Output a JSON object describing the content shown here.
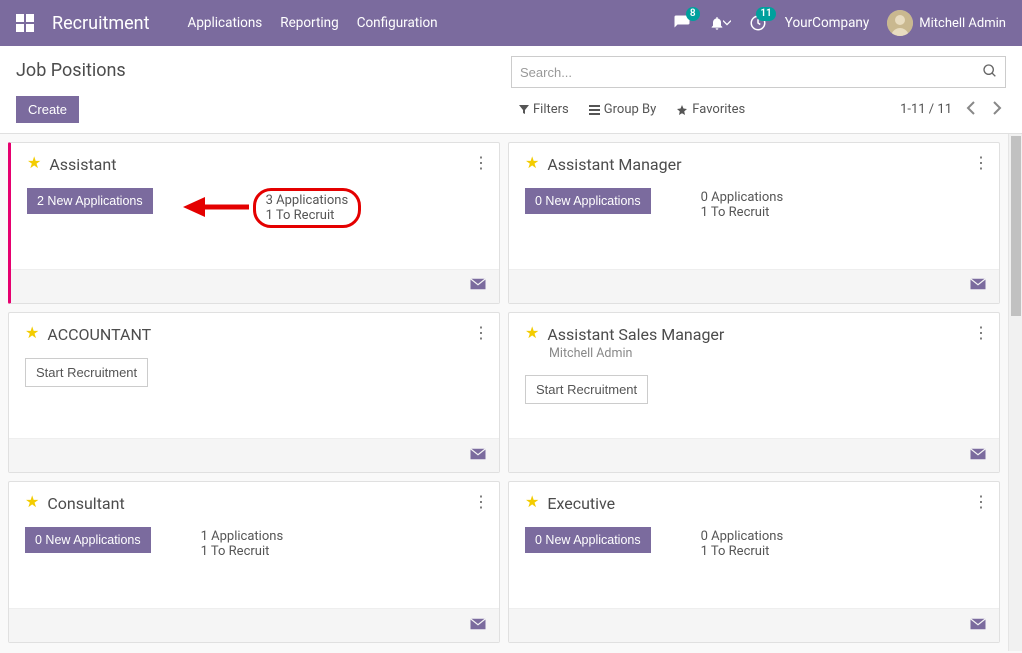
{
  "nav": {
    "brand": "Recruitment",
    "menus": [
      "Applications",
      "Reporting",
      "Configuration"
    ],
    "chat_badge": "8",
    "activity_badge": "11",
    "company": "YourCompany",
    "user": "Mitchell Admin"
  },
  "cp": {
    "title": "Job Positions",
    "create": "Create",
    "search_placeholder": "Search...",
    "filters": "Filters",
    "groupby": "Group By",
    "favorites": "Favorites",
    "pager": "1-11 / 11"
  },
  "cards": [
    {
      "title": "Assistant",
      "highlight": true,
      "new_apps": "2 New Applications",
      "s1": "3 Applications",
      "s2": "1 To Recruit",
      "stats_highlight": true,
      "arrow": true
    },
    {
      "title": "Assistant Manager",
      "new_apps": "0 New Applications",
      "s1": "0 Applications",
      "s2": "1 To Recruit"
    },
    {
      "title": "ACCOUNTANT",
      "start_btn": "Start Recruitment"
    },
    {
      "title": "Assistant Sales Manager",
      "subtitle": "Mitchell Admin",
      "start_btn": "Start Recruitment"
    },
    {
      "title": "Consultant",
      "new_apps": "0 New Applications",
      "s1": "1 Applications",
      "s2": "1 To Recruit"
    },
    {
      "title": "Executive",
      "new_apps": "0 New Applications",
      "s1": "0 Applications",
      "s2": "1 To Recruit"
    }
  ]
}
